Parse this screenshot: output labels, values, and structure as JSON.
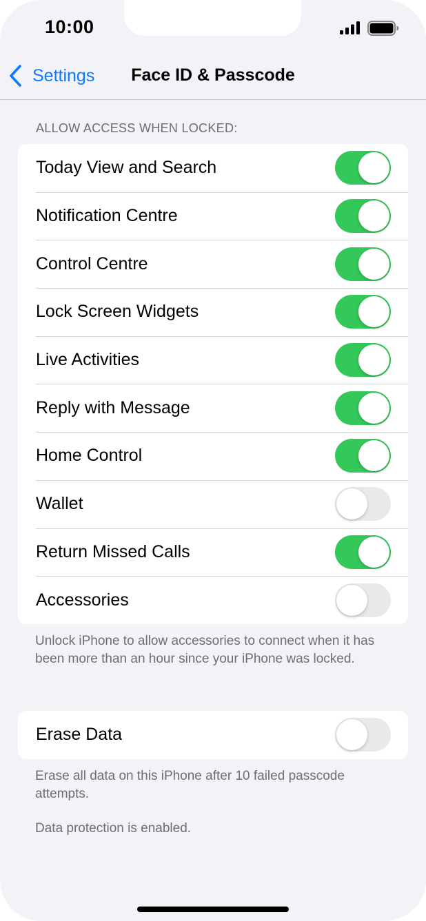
{
  "status_bar": {
    "time": "10:00",
    "signal_icon": "cellular-signal-icon",
    "battery_icon": "battery-icon"
  },
  "nav": {
    "back_label": "Settings",
    "back_icon": "chevron-left-icon",
    "title": "Face ID & Passcode"
  },
  "allow_access": {
    "header": "ALLOW ACCESS WHEN LOCKED:",
    "items": [
      {
        "label": "Today View and Search",
        "on": true
      },
      {
        "label": "Notification Centre",
        "on": true
      },
      {
        "label": "Control Centre",
        "on": true
      },
      {
        "label": "Lock Screen Widgets",
        "on": true
      },
      {
        "label": "Live Activities",
        "on": true
      },
      {
        "label": "Reply with Message",
        "on": true
      },
      {
        "label": "Home Control",
        "on": true
      },
      {
        "label": "Wallet",
        "on": false
      },
      {
        "label": "Return Missed Calls",
        "on": true
      },
      {
        "label": "Accessories",
        "on": false
      }
    ],
    "footer": "Unlock iPhone to allow accessories to connect when it has been more than an hour since your iPhone was locked."
  },
  "erase": {
    "label": "Erase Data",
    "on": false,
    "footer": "Erase all data on this iPhone after 10 failed passcode attempts.",
    "protection_note": "Data protection is enabled."
  },
  "colors": {
    "accent": "#0a7aff",
    "toggle_on": "#34c759",
    "toggle_off": "#e9e9ea",
    "background": "#f2f2f7"
  }
}
